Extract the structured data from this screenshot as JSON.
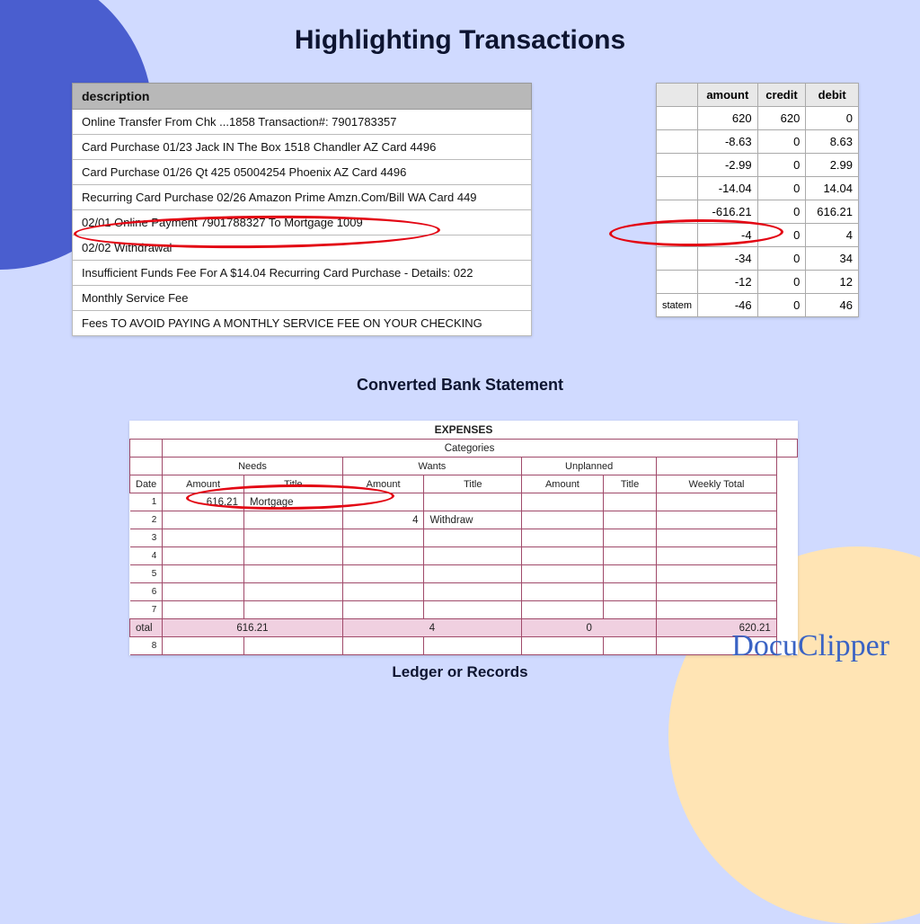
{
  "title": "Highlighting Transactions",
  "caption1": "Converted Bank Statement",
  "caption2": "Ledger or Records",
  "logo": "DocuClipper",
  "desc": {
    "header": "description",
    "rows": [
      "Online Transfer From Chk ...1858 Transaction#: 7901783357",
      "Card Purchase 01/23 Jack IN The Box 1518 Chandler AZ Card 4496",
      "Card Purchase 01/26 Qt 425 05004254 Phoenix AZ Card 4496",
      "Recurring Card Purchase 02/26 Amazon Prime Amzn.Com/Bill WA Card 449",
      "02/01 Online Payment 7901788327 To Mortgage 1009",
      "02/02 Withdrawal",
      "Insufficient Funds Fee For A $14.04 Recurring Card Purchase - Details: 022",
      "Monthly Service Fee",
      "Fees TO AVOID PAYING A MONTHLY SERVICE FEE ON YOUR CHECKING"
    ]
  },
  "amt": {
    "headers": [
      "",
      "amount",
      "credit",
      "debit"
    ],
    "rows": [
      [
        "",
        "620",
        "620",
        "0"
      ],
      [
        "",
        "-8.63",
        "0",
        "8.63"
      ],
      [
        "",
        "-2.99",
        "0",
        "2.99"
      ],
      [
        "",
        "-14.04",
        "0",
        "14.04"
      ],
      [
        "",
        "-616.21",
        "0",
        "616.21"
      ],
      [
        "",
        "-4",
        "0",
        "4"
      ],
      [
        "",
        "-34",
        "0",
        "34"
      ],
      [
        "",
        "-12",
        "0",
        "12"
      ],
      [
        "statem",
        "-46",
        "0",
        "46"
      ]
    ]
  },
  "ledger": {
    "expenses_label": "EXPENSES",
    "categories_label": "Categories",
    "groups": [
      "Needs",
      "Wants",
      "Unplanned"
    ],
    "cols": {
      "date": "Date",
      "amount": "Amount",
      "title": "Title",
      "weekly": "Weekly Total"
    },
    "rows": [
      {
        "n": "1",
        "needs_amount": "616.21",
        "needs_title": "Mortgage",
        "wants_amount": "",
        "wants_title": "",
        "un_amount": "",
        "un_title": ""
      },
      {
        "n": "2",
        "needs_amount": "",
        "needs_title": "",
        "wants_amount": "4",
        "wants_title": "Withdraw",
        "un_amount": "",
        "un_title": ""
      },
      {
        "n": "3",
        "needs_amount": "",
        "needs_title": "",
        "wants_amount": "",
        "wants_title": "",
        "un_amount": "",
        "un_title": ""
      },
      {
        "n": "4",
        "needs_amount": "",
        "needs_title": "",
        "wants_amount": "",
        "wants_title": "",
        "un_amount": "",
        "un_title": ""
      },
      {
        "n": "5",
        "needs_amount": "",
        "needs_title": "",
        "wants_amount": "",
        "wants_title": "",
        "un_amount": "",
        "un_title": ""
      },
      {
        "n": "6",
        "needs_amount": "",
        "needs_title": "",
        "wants_amount": "",
        "wants_title": "",
        "un_amount": "",
        "un_title": ""
      },
      {
        "n": "7",
        "needs_amount": "",
        "needs_title": "",
        "wants_amount": "",
        "wants_title": "",
        "un_amount": "",
        "un_title": ""
      }
    ],
    "total_label": "otal",
    "totals": {
      "needs": "616.21",
      "wants": "4",
      "unplanned": "0",
      "weekly": "620.21"
    },
    "last_row_n": "8"
  }
}
